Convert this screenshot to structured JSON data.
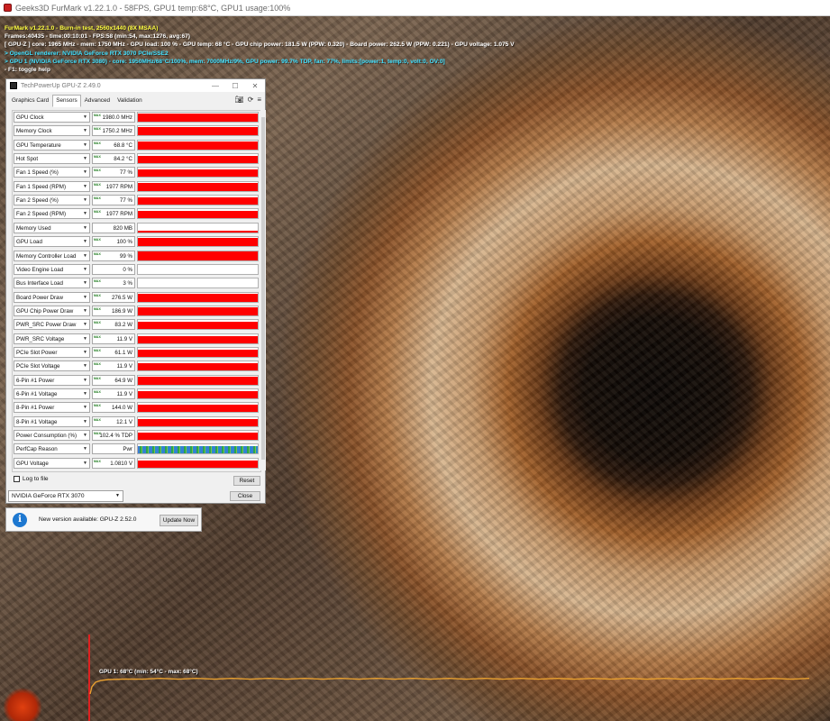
{
  "furmark": {
    "window_title": "Geeks3D FurMark v1.22.1.0 - 58FPS, GPU1 temp:68°C, GPU1 usage:100%",
    "overlay": [
      {
        "text": "FurMark v1.22.1.0 - Burn-in test, 2560x1440 (8X MSAA)",
        "color": "#ffff40"
      },
      {
        "text": "Frames:40435 - time:00:10:01 - FPS:58 (min:54, max:1276, avg:67)",
        "color": "#ffffff"
      },
      {
        "text": "[ GPU-Z ] core: 1965 MHz - mem: 1750 MHz - GPU load: 100 % - GPU temp: 68 °C - GPU chip power: 181.5 W (PPW: 0.320) - Board power: 262.5 W (PPW: 0.221) - GPU voltage: 1.075 V",
        "color": "#ffffff"
      },
      {
        "text": "> OpenGL renderer: NVIDIA GeForce RTX 3070 PCIe/SSE2",
        "color": "#40e0ff"
      },
      {
        "text": "> GPU 1 (NVIDIA GeForce RTX 3080) - core: 1950MHz/68°C/100%, mem: 7000MHz/9%, GPU power: 99.7% TDP, fan: 77%, limits:[power:1, temp:0, volt:0, OV:0]",
        "color": "#40e0ff"
      },
      {
        "text": "- F1: toggle help",
        "color": "#ffffff"
      }
    ],
    "temp_graph_label": "GPU 1: 68°C (min: 54°C - max: 68°C)",
    "temp_line_color": "#e8a030"
  },
  "gpuz": {
    "title": "TechPowerUp GPU-Z 2.49.0",
    "tabs": [
      "Graphics Card",
      "Sensors",
      "Advanced",
      "Validation"
    ],
    "active_tab": "Sensors",
    "max_tag": "MAX",
    "sensors": [
      {
        "label": "GPU Clock",
        "value": "1980.0 MHz",
        "max": true,
        "level": 0.9
      },
      {
        "label": "Memory Clock",
        "value": "1750.2 MHz",
        "max": true,
        "level": 0.9
      },
      {
        "label": "GPU Temperature",
        "value": "68.8 °C",
        "max": true,
        "level": 0.85
      },
      {
        "label": "Hot Spot",
        "value": "84.2 °C",
        "max": true,
        "level": 0.85
      },
      {
        "label": "Fan 1 Speed (%)",
        "value": "77 %",
        "max": true,
        "level": 0.85
      },
      {
        "label": "Fan 1 Speed (RPM)",
        "value": "1977 RPM",
        "max": true,
        "level": 0.85
      },
      {
        "label": "Fan 2 Speed (%)",
        "value": "77 %",
        "max": true,
        "level": 0.85
      },
      {
        "label": "Fan 2 Speed (RPM)",
        "value": "1977 RPM",
        "max": true,
        "level": 0.85
      },
      {
        "label": "Memory Used",
        "value": "820 MB",
        "max": false,
        "level": 0.15
      },
      {
        "label": "GPU Load",
        "value": "100 %",
        "max": true,
        "level": 0.95
      },
      {
        "label": "Memory Controller Load",
        "value": "99 %",
        "max": true,
        "level": 0.95
      },
      {
        "label": "Video Engine Load",
        "value": "0 %",
        "max": false,
        "level": 0
      },
      {
        "label": "Bus Interface Load",
        "value": "3 %",
        "max": true,
        "level": 0.05
      },
      {
        "label": "Board Power Draw",
        "value": "276.5 W",
        "max": true,
        "level": 0.85
      },
      {
        "label": "GPU Chip Power Draw",
        "value": "186.9 W",
        "max": true,
        "level": 0.85
      },
      {
        "label": "PWR_SRC Power Draw",
        "value": "83.2 W",
        "max": true,
        "level": 0.8
      },
      {
        "label": "PWR_SRC Voltage",
        "value": "11.9 V",
        "max": true,
        "level": 0.8
      },
      {
        "label": "PCIe Slot Power",
        "value": "61.1 W",
        "max": true,
        "level": 0.8
      },
      {
        "label": "PCIe Slot Voltage",
        "value": "11.9 V",
        "max": true,
        "level": 0.8
      },
      {
        "label": "6-Pin #1 Power",
        "value": "64.9 W",
        "max": true,
        "level": 0.85
      },
      {
        "label": "6-Pin #1 Voltage",
        "value": "11.9 V",
        "max": true,
        "level": 0.8
      },
      {
        "label": "8-Pin #1 Power",
        "value": "144.0 W",
        "max": true,
        "level": 0.85
      },
      {
        "label": "8-Pin #1 Voltage",
        "value": "12.1 V",
        "max": true,
        "level": 0.8
      },
      {
        "label": "Power Consumption (%)",
        "value": "102.4 % TDP",
        "max": true,
        "level": 0.85
      },
      {
        "label": "PerfCap Reason",
        "value": "Pwr",
        "max": false,
        "level": 0.8,
        "perf": true
      },
      {
        "label": "GPU Voltage",
        "value": "1.0810 V",
        "max": true,
        "level": 0.8
      }
    ],
    "log_to_file": "Log to file",
    "reset_label": "Reset",
    "device": "NVIDIA GeForce RTX 3070",
    "close_label": "Close"
  },
  "notification": {
    "message": "New version available: GPU-Z 2.52.0",
    "button": "Update Now"
  },
  "colors": {
    "graph_fill": "#ff0000",
    "info_blue": "#1e78d0"
  }
}
